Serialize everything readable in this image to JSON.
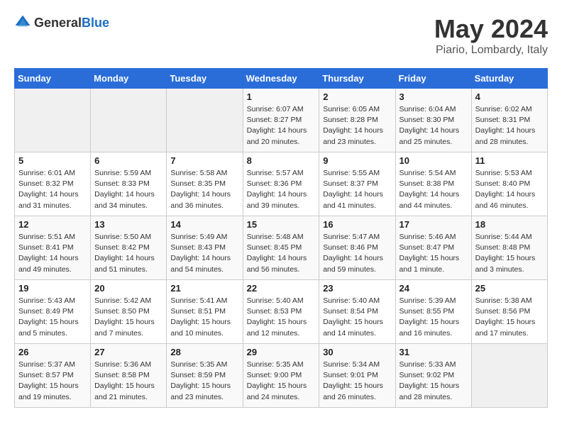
{
  "header": {
    "logo_general": "General",
    "logo_blue": "Blue",
    "title": "May 2024",
    "subtitle": "Piario, Lombardy, Italy"
  },
  "weekdays": [
    "Sunday",
    "Monday",
    "Tuesday",
    "Wednesday",
    "Thursday",
    "Friday",
    "Saturday"
  ],
  "weeks": [
    [
      {
        "day": "",
        "sunrise": "",
        "sunset": "",
        "daylight": ""
      },
      {
        "day": "",
        "sunrise": "",
        "sunset": "",
        "daylight": ""
      },
      {
        "day": "",
        "sunrise": "",
        "sunset": "",
        "daylight": ""
      },
      {
        "day": "1",
        "sunrise": "Sunrise: 6:07 AM",
        "sunset": "Sunset: 8:27 PM",
        "daylight": "Daylight: 14 hours and 20 minutes."
      },
      {
        "day": "2",
        "sunrise": "Sunrise: 6:05 AM",
        "sunset": "Sunset: 8:28 PM",
        "daylight": "Daylight: 14 hours and 23 minutes."
      },
      {
        "day": "3",
        "sunrise": "Sunrise: 6:04 AM",
        "sunset": "Sunset: 8:30 PM",
        "daylight": "Daylight: 14 hours and 25 minutes."
      },
      {
        "day": "4",
        "sunrise": "Sunrise: 6:02 AM",
        "sunset": "Sunset: 8:31 PM",
        "daylight": "Daylight: 14 hours and 28 minutes."
      }
    ],
    [
      {
        "day": "5",
        "sunrise": "Sunrise: 6:01 AM",
        "sunset": "Sunset: 8:32 PM",
        "daylight": "Daylight: 14 hours and 31 minutes."
      },
      {
        "day": "6",
        "sunrise": "Sunrise: 5:59 AM",
        "sunset": "Sunset: 8:33 PM",
        "daylight": "Daylight: 14 hours and 34 minutes."
      },
      {
        "day": "7",
        "sunrise": "Sunrise: 5:58 AM",
        "sunset": "Sunset: 8:35 PM",
        "daylight": "Daylight: 14 hours and 36 minutes."
      },
      {
        "day": "8",
        "sunrise": "Sunrise: 5:57 AM",
        "sunset": "Sunset: 8:36 PM",
        "daylight": "Daylight: 14 hours and 39 minutes."
      },
      {
        "day": "9",
        "sunrise": "Sunrise: 5:55 AM",
        "sunset": "Sunset: 8:37 PM",
        "daylight": "Daylight: 14 hours and 41 minutes."
      },
      {
        "day": "10",
        "sunrise": "Sunrise: 5:54 AM",
        "sunset": "Sunset: 8:38 PM",
        "daylight": "Daylight: 14 hours and 44 minutes."
      },
      {
        "day": "11",
        "sunrise": "Sunrise: 5:53 AM",
        "sunset": "Sunset: 8:40 PM",
        "daylight": "Daylight: 14 hours and 46 minutes."
      }
    ],
    [
      {
        "day": "12",
        "sunrise": "Sunrise: 5:51 AM",
        "sunset": "Sunset: 8:41 PM",
        "daylight": "Daylight: 14 hours and 49 minutes."
      },
      {
        "day": "13",
        "sunrise": "Sunrise: 5:50 AM",
        "sunset": "Sunset: 8:42 PM",
        "daylight": "Daylight: 14 hours and 51 minutes."
      },
      {
        "day": "14",
        "sunrise": "Sunrise: 5:49 AM",
        "sunset": "Sunset: 8:43 PM",
        "daylight": "Daylight: 14 hours and 54 minutes."
      },
      {
        "day": "15",
        "sunrise": "Sunrise: 5:48 AM",
        "sunset": "Sunset: 8:45 PM",
        "daylight": "Daylight: 14 hours and 56 minutes."
      },
      {
        "day": "16",
        "sunrise": "Sunrise: 5:47 AM",
        "sunset": "Sunset: 8:46 PM",
        "daylight": "Daylight: 14 hours and 59 minutes."
      },
      {
        "day": "17",
        "sunrise": "Sunrise: 5:46 AM",
        "sunset": "Sunset: 8:47 PM",
        "daylight": "Daylight: 15 hours and 1 minute."
      },
      {
        "day": "18",
        "sunrise": "Sunrise: 5:44 AM",
        "sunset": "Sunset: 8:48 PM",
        "daylight": "Daylight: 15 hours and 3 minutes."
      }
    ],
    [
      {
        "day": "19",
        "sunrise": "Sunrise: 5:43 AM",
        "sunset": "Sunset: 8:49 PM",
        "daylight": "Daylight: 15 hours and 5 minutes."
      },
      {
        "day": "20",
        "sunrise": "Sunrise: 5:42 AM",
        "sunset": "Sunset: 8:50 PM",
        "daylight": "Daylight: 15 hours and 7 minutes."
      },
      {
        "day": "21",
        "sunrise": "Sunrise: 5:41 AM",
        "sunset": "Sunset: 8:51 PM",
        "daylight": "Daylight: 15 hours and 10 minutes."
      },
      {
        "day": "22",
        "sunrise": "Sunrise: 5:40 AM",
        "sunset": "Sunset: 8:53 PM",
        "daylight": "Daylight: 15 hours and 12 minutes."
      },
      {
        "day": "23",
        "sunrise": "Sunrise: 5:40 AM",
        "sunset": "Sunset: 8:54 PM",
        "daylight": "Daylight: 15 hours and 14 minutes."
      },
      {
        "day": "24",
        "sunrise": "Sunrise: 5:39 AM",
        "sunset": "Sunset: 8:55 PM",
        "daylight": "Daylight: 15 hours and 16 minutes."
      },
      {
        "day": "25",
        "sunrise": "Sunrise: 5:38 AM",
        "sunset": "Sunset: 8:56 PM",
        "daylight": "Daylight: 15 hours and 17 minutes."
      }
    ],
    [
      {
        "day": "26",
        "sunrise": "Sunrise: 5:37 AM",
        "sunset": "Sunset: 8:57 PM",
        "daylight": "Daylight: 15 hours and 19 minutes."
      },
      {
        "day": "27",
        "sunrise": "Sunrise: 5:36 AM",
        "sunset": "Sunset: 8:58 PM",
        "daylight": "Daylight: 15 hours and 21 minutes."
      },
      {
        "day": "28",
        "sunrise": "Sunrise: 5:35 AM",
        "sunset": "Sunset: 8:59 PM",
        "daylight": "Daylight: 15 hours and 23 minutes."
      },
      {
        "day": "29",
        "sunrise": "Sunrise: 5:35 AM",
        "sunset": "Sunset: 9:00 PM",
        "daylight": "Daylight: 15 hours and 24 minutes."
      },
      {
        "day": "30",
        "sunrise": "Sunrise: 5:34 AM",
        "sunset": "Sunset: 9:01 PM",
        "daylight": "Daylight: 15 hours and 26 minutes."
      },
      {
        "day": "31",
        "sunrise": "Sunrise: 5:33 AM",
        "sunset": "Sunset: 9:02 PM",
        "daylight": "Daylight: 15 hours and 28 minutes."
      },
      {
        "day": "",
        "sunrise": "",
        "sunset": "",
        "daylight": ""
      }
    ]
  ]
}
